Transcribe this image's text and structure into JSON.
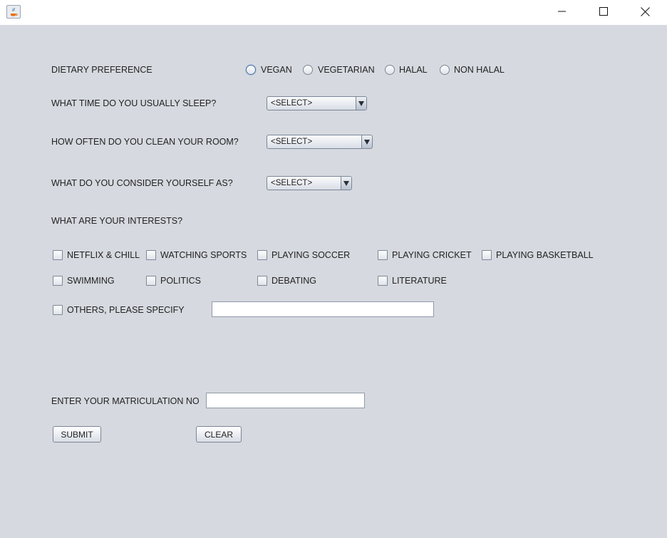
{
  "window": {
    "minimize_glyph": "—",
    "maximize_glyph": "☐",
    "close_glyph": "✕"
  },
  "dietary": {
    "label": "DIETARY PREFERENCE",
    "options": [
      "VEGAN",
      "VEGETARIAN",
      "HALAL",
      "NON HALAL"
    ]
  },
  "sleep": {
    "label": "WHAT TIME DO YOU USUALLY SLEEP?",
    "value": "<SELECT>"
  },
  "clean": {
    "label": "HOW OFTEN DO YOU CLEAN YOUR ROOM?",
    "value": "<SELECT>"
  },
  "consider": {
    "label": "WHAT DO YOU CONSIDER YOURSELF AS?",
    "value": "<SELECT>"
  },
  "interests": {
    "label": "WHAT ARE YOUR INTERESTS?",
    "row1": [
      "NETFLIX & CHILL",
      "WATCHING SPORTS",
      "PLAYING SOCCER",
      "PLAYING CRICKET",
      "PLAYING BASKETBALL"
    ],
    "row2": [
      "SWIMMING",
      "POLITICS",
      "DEBATING",
      "LITERATURE"
    ],
    "others_label": "OTHERS, PLEASE SPECIFY",
    "others_value": ""
  },
  "matric": {
    "label": "ENTER YOUR MATRICULATION NO",
    "value": ""
  },
  "buttons": {
    "submit": "SUBMIT",
    "clear": "CLEAR"
  }
}
